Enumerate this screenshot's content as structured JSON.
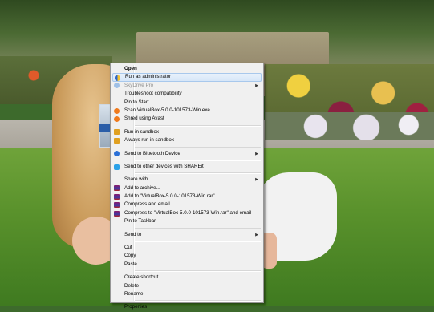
{
  "context_menu": {
    "items": [
      {
        "label": "Open",
        "bold": true
      },
      {
        "label": "Run as administrator",
        "icon": "uac-shield-icon",
        "highlighted": true
      },
      {
        "label": "SkyDrive Pro",
        "icon": "skydrive-icon",
        "disabled": true,
        "submenu": true
      },
      {
        "label": "Troubleshoot compatibility"
      },
      {
        "label": "Pin to Start"
      },
      {
        "label": "Scan VirtualBox-5.0.0-101573-Win.exe",
        "icon": "avast-icon"
      },
      {
        "label": "Shred using Avast",
        "icon": "avast-icon"
      },
      {
        "label": "Run in sandbox",
        "icon": "sandbox-icon"
      },
      {
        "label": "Always run in sandbox",
        "icon": "sandbox-icon"
      },
      {
        "label": "Send to Bluetooth Device",
        "icon": "bluetooth-icon",
        "submenu": true
      },
      {
        "label": "Send to other devices with SHAREit",
        "icon": "shareit-icon"
      },
      {
        "label": "Share with",
        "submenu": true
      },
      {
        "label": "Add to archive...",
        "icon": "winrar-icon"
      },
      {
        "label": "Add to \"VirtualBox-5.0.0-101573-Win.rar\"",
        "icon": "winrar-icon"
      },
      {
        "label": "Compress and email...",
        "icon": "winrar-icon"
      },
      {
        "label": "Compress to \"VirtualBox-5.0.0-101573-Win.rar\" and email",
        "icon": "winrar-icon"
      },
      {
        "label": "Pin to Taskbar"
      },
      {
        "label": "Send to",
        "submenu": true
      },
      {
        "label": "Cut"
      },
      {
        "label": "Copy"
      },
      {
        "label": "Paste"
      },
      {
        "label": "Create shortcut"
      },
      {
        "label": "Delete"
      },
      {
        "label": "Rename"
      },
      {
        "label": "Properties"
      }
    ],
    "submenu_arrow": "▶"
  },
  "colors": {
    "menu_background": "#f0f0f0",
    "highlight_background": "#d6e6f8",
    "highlight_border": "#a8c8ec",
    "disabled_text": "#8d8d8d"
  }
}
